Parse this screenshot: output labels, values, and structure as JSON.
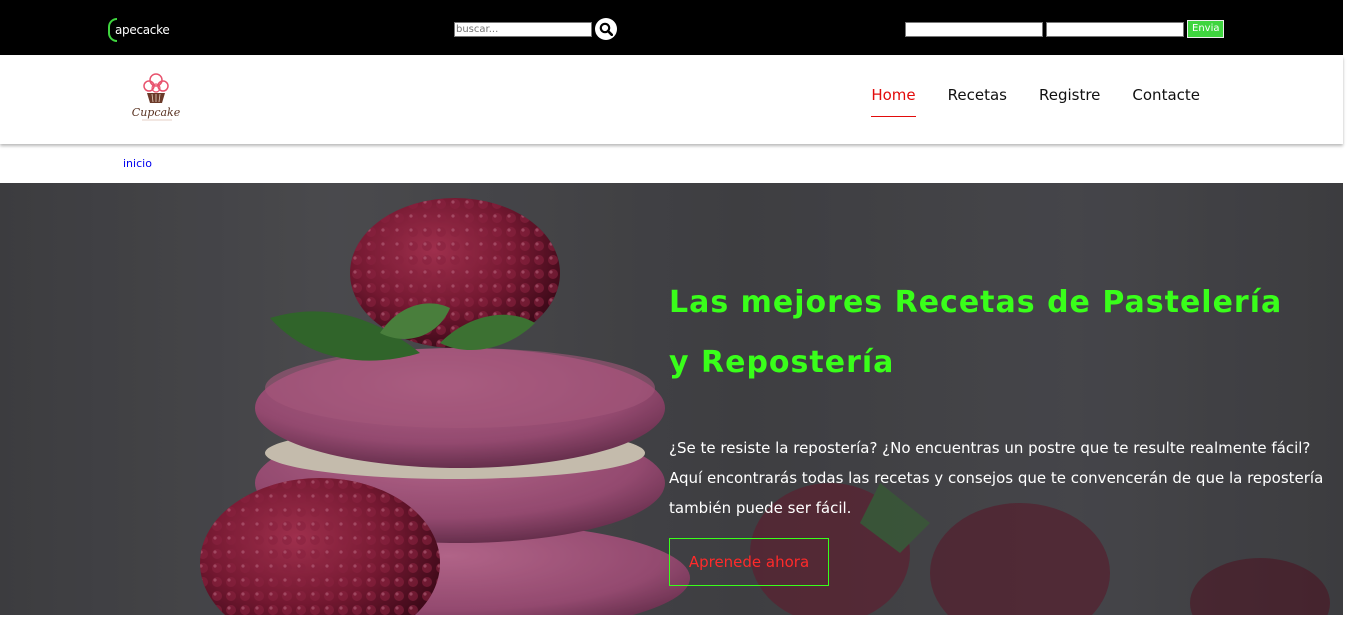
{
  "topbar": {
    "brand_text": "apecacke",
    "search": {
      "placeholder": "buscar..."
    },
    "login": {
      "submit_label": "Envia"
    }
  },
  "header": {
    "logo_text": "Cupcake",
    "nav": [
      {
        "label": "Home",
        "active": true
      },
      {
        "label": "Recetas"
      },
      {
        "label": "Registre"
      },
      {
        "label": "Contacte"
      }
    ]
  },
  "breadcrumb": {
    "label": "inicio"
  },
  "hero": {
    "title": "Las mejores Recetas de Pastelería y Repostería",
    "text": "¿Se te resiste la repostería? ¿No encuentras un postre que te resulte realmente fácil? Aquí encontrarás todas las recetas y consejos que te convencerán de que la repostería también puede ser fácil.",
    "button_label": "Aprenede ahora"
  },
  "colors": {
    "accent_green": "#39ff1a",
    "nav_active": "#e20b0b",
    "topbar_bg": "#000000"
  }
}
